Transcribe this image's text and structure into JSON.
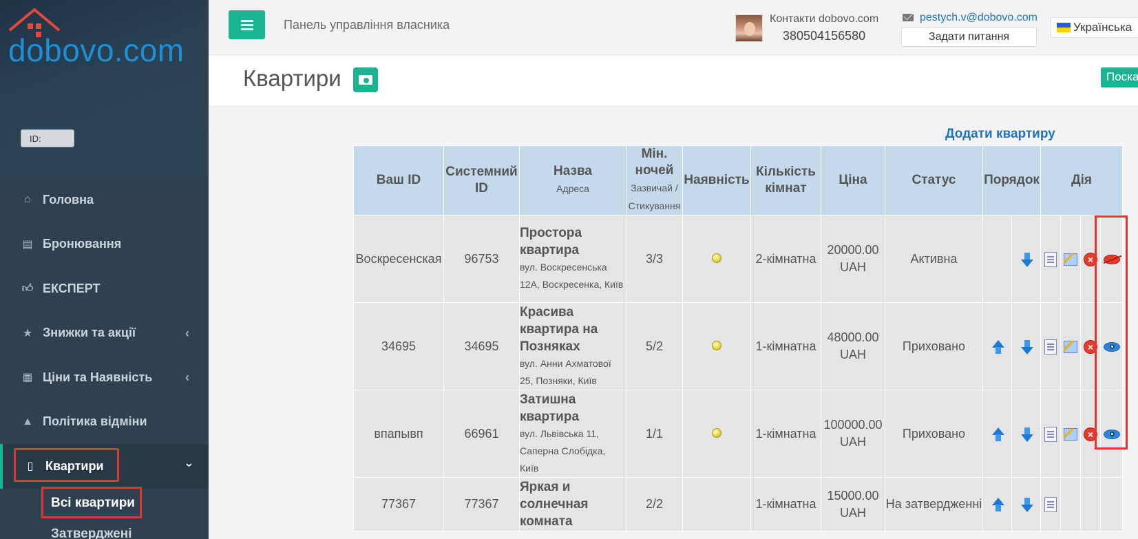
{
  "sidebar": {
    "logo": "dobovo.com",
    "id_label": "ID:",
    "items": [
      {
        "label": "Головна",
        "icon": "home-icon"
      },
      {
        "label": "Бронювання",
        "icon": "book-icon"
      },
      {
        "label": "ЕКСПЕРТ",
        "icon": "thumbs-up-icon"
      },
      {
        "label": "Знижки та акції",
        "icon": "star-icon"
      },
      {
        "label": "Ціни та Наявність",
        "icon": "calendar-icon"
      },
      {
        "label": "Політика відміни",
        "icon": "warning-icon"
      },
      {
        "label": "Квартири",
        "icon": "building-icon"
      }
    ],
    "sub_items": [
      "Всі квартири",
      "Затверджені"
    ]
  },
  "header": {
    "panel_title": "Панель управління власника",
    "contacts_label": "Контакти dobovo.com",
    "contacts_phone": "380504156580",
    "email": "pestych.v@dobovo.com",
    "ask_button": "Задати питання",
    "language": "Українська"
  },
  "page": {
    "title": "Квартири",
    "search_button": "Поска",
    "add_link": "Додати квартиру"
  },
  "table": {
    "headers": {
      "your_id": "Ваш ID",
      "system_id": "Системний ID",
      "name": "Назва",
      "name_sub": "Адреса",
      "min_nights": "Мін. ночей",
      "min_nights_sub": "Зазвичай / Стикування",
      "availability": "Наявність",
      "rooms": "Кількість кімнат",
      "price": "Ціна",
      "status": "Статус",
      "order": "Порядок",
      "action": "Дія"
    },
    "rows": [
      {
        "your_id": "Воскресенская",
        "system_id": "96753",
        "name": "Простора квартира",
        "address": "вул. Воскресенська 12А, Воскресенка, Київ",
        "min_nights": "3/3",
        "rooms": "2-кімнатна",
        "price": "20000.00",
        "currency": "UAH",
        "status": "Активна"
      },
      {
        "your_id": "34695",
        "system_id": "34695",
        "name": "Красива квартира на Позняках",
        "address": "вул. Анни Ахматової 25, Позняки, Київ",
        "min_nights": "5/2",
        "rooms": "1-кімнатна",
        "price": "48000.00",
        "currency": "UAH",
        "status": "Приховано"
      },
      {
        "your_id": "впапывп",
        "system_id": "66961",
        "name": "Затишна квартира",
        "address": "вул. Львівська 11, Саперна Слобідка, Київ",
        "min_nights": "1/1",
        "rooms": "1-кімнатна",
        "price": "100000.00",
        "currency": "UAH",
        "status": "Приховано"
      },
      {
        "your_id": "77367",
        "system_id": "77367",
        "name": "Яркая и солнечная комната",
        "address": "",
        "min_nights": "2/2",
        "rooms": "1-кімнатна",
        "price": "15000.00",
        "currency": "UAH",
        "status": "На затвердженні"
      }
    ]
  },
  "colors": {
    "accent": "#1ab394",
    "sidebar": "#2f4050",
    "link": "#1e73be",
    "highlight": "#e3342f",
    "table_header": "#c5d9ec"
  }
}
